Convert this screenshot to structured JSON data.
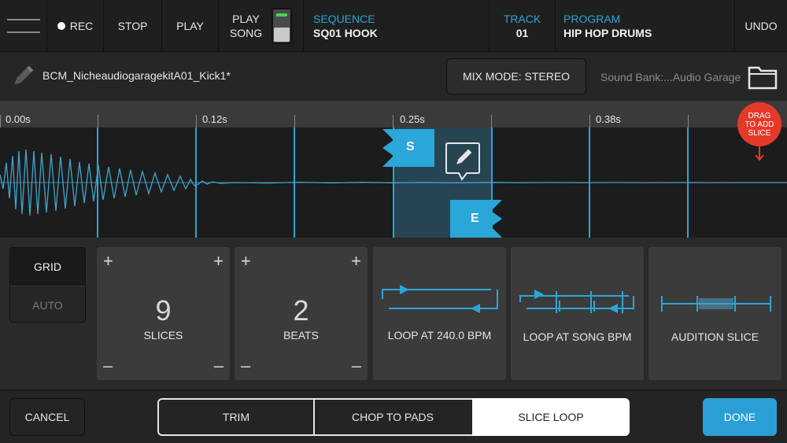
{
  "topbar": {
    "rec": "REC",
    "stop": "STOP",
    "play": "PLAY",
    "play_song_1": "PLAY",
    "play_song_2": "SONG",
    "sequence_label": "SEQUENCE",
    "sequence_value": "SQ01 HOOK",
    "track_label": "TRACK",
    "track_value": "01",
    "program_label": "PROGRAM",
    "program_value": "HIP HOP DRUMS",
    "undo": "UNDO"
  },
  "sample": {
    "name": "BCM_NicheaudiogaragekitA01_Kick1*",
    "mix_mode": "MIX MODE: STEREO",
    "sound_bank": "Sound Bank:...Audio Garage"
  },
  "timeline": {
    "ticks": [
      "0.00s",
      "0.12s",
      "0.25s",
      "0.38s"
    ],
    "start_marker": "S",
    "end_marker": "E",
    "drag_hint_1": "DRAG",
    "drag_hint_2": "TO ADD",
    "drag_hint_3": "SLICE"
  },
  "controls": {
    "grid": "GRID",
    "auto": "AUTO",
    "slices_value": "9",
    "slices_label": "SLICES",
    "beats_value": "2",
    "beats_label": "BEATS",
    "plus": "+",
    "minus": "–",
    "loop_bpm": "LOOP AT 240.0 BPM",
    "loop_song_bpm": "LOOP AT SONG BPM",
    "audition_slice": "AUDITION SLICE"
  },
  "bottom": {
    "cancel": "CANCEL",
    "trim": "TRIM",
    "chop": "CHOP TO PADS",
    "slice_loop": "SLICE LOOP",
    "done": "DONE"
  },
  "colors": {
    "accent": "#2aa6d8",
    "drag_red": "#e53a2b",
    "done_blue": "#2a9fd6"
  },
  "icons": {
    "menu": "hamburger-icon",
    "sample": "pencil-icon",
    "folder": "folder-icon",
    "edit": "pencil-bubble-icon"
  }
}
